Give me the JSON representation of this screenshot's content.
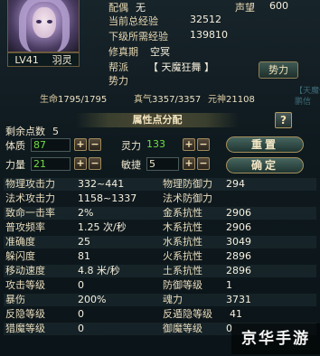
{
  "profile": {
    "level": "LV41",
    "class_name": "羽灵",
    "rows": [
      {
        "key": "配偶",
        "value": "无"
      },
      {
        "key": "当前总经验",
        "value": "32512"
      },
      {
        "key": "下级所需经验",
        "value": "139810"
      },
      {
        "key": "修真期",
        "value": "空冥"
      },
      {
        "key": "帮派",
        "value": "【 天魔狂舞 】"
      },
      {
        "key": "势力",
        "value": ""
      }
    ],
    "prestige_label": "声望",
    "prestige_value": "600",
    "power_button": "势力"
  },
  "vitals": {
    "hp_label": "生命",
    "hp_value": "1795/1795",
    "qi_label": "真气",
    "qi_value": "3357/3357",
    "spirit_label": "元神",
    "spirit_value": "21108"
  },
  "side_decor_text": "【天魔任\n鹏信",
  "allocation": {
    "title": "属性点分配",
    "help_label": "?",
    "remaining_label": "剩余点数",
    "remaining_value": "5",
    "stats": [
      {
        "label": "体质",
        "value": "87"
      },
      {
        "label": "力量",
        "value": "21"
      },
      {
        "label": "灵力",
        "value": "133"
      },
      {
        "label": "敏捷",
        "value": "5"
      }
    ],
    "plus": "+",
    "minus": "−",
    "reset_button": "重置",
    "confirm_button": "确定"
  },
  "stats_table": [
    {
      "lk": "物理攻击力",
      "lv": "332~441",
      "rk": "物理防御力",
      "rv": "294"
    },
    {
      "lk": "法术攻击力",
      "lv": "1158~1337",
      "rk": "法术防御力",
      "rv": ""
    },
    {
      "lk": "致命一击率",
      "lv": "2%",
      "rk": "金系抗性",
      "rv": "2906"
    },
    {
      "lk": "普攻频率",
      "lv": "1.25 次/秒",
      "rk": "木系抗性",
      "rv": "2906"
    },
    {
      "lk": "准确度",
      "lv": "25",
      "rk": "水系抗性",
      "rv": "3049"
    },
    {
      "lk": "躲闪度",
      "lv": "81",
      "rk": "火系抗性",
      "rv": "2896"
    },
    {
      "lk": "移动速度",
      "lv": "4.8 米/秒",
      "rk": "土系抗性",
      "rv": "2896"
    },
    {
      "lk": "攻击等级",
      "lv": "0",
      "rk": "防御等级",
      "rv": "1"
    },
    {
      "lk": "暴伤",
      "lv": "200%",
      "rk": "魂力",
      "rv": "3731"
    },
    {
      "lk": "反隐等级",
      "lv": "0",
      "rk": "反遁隐等级",
      "rv": "41"
    },
    {
      "lk": "猎魔等级",
      "lv": "0",
      "rk": "御魔等级",
      "rv": "0"
    }
  ],
  "watermark": "京华手游"
}
